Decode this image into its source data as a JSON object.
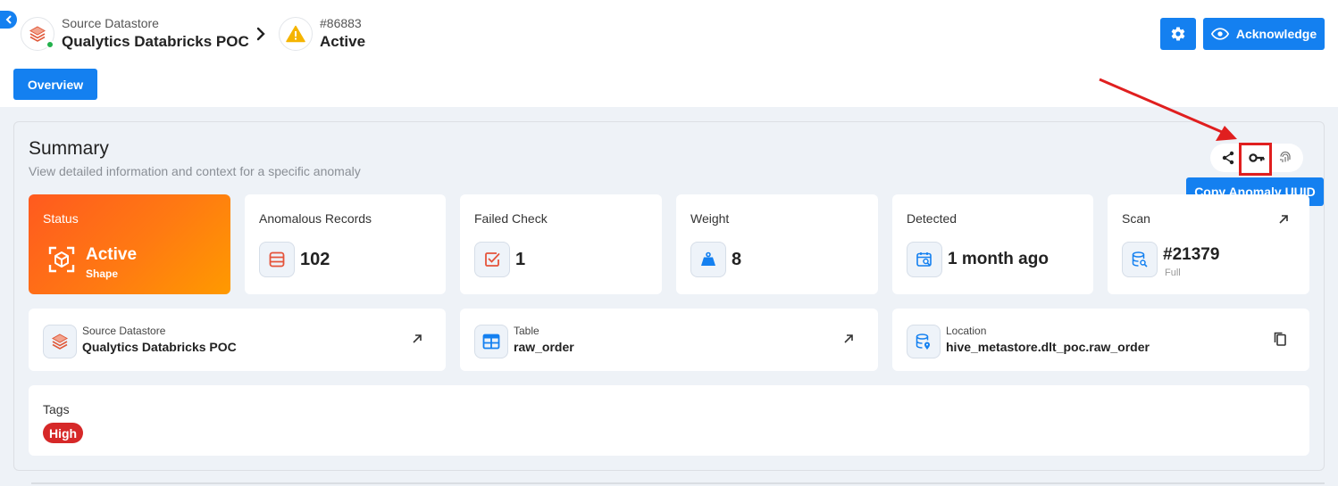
{
  "breadcrumb": {
    "datastore_kicker": "Source Datastore",
    "datastore_name": "Qualytics Databricks POC",
    "anomaly_id": "#86883",
    "anomaly_status": "Active"
  },
  "toolbar": {
    "acknowledge_label": "Acknowledge"
  },
  "tabs": [
    {
      "label": "Overview",
      "active": true
    }
  ],
  "summary": {
    "title": "Summary",
    "subtitle": "View detailed information and context for a specific anomaly",
    "tooltip": "Copy Anomaly UUID"
  },
  "metrics": {
    "status": {
      "label": "Status",
      "value": "Active",
      "sub": "Shape"
    },
    "anomalous_records": {
      "label": "Anomalous Records",
      "value": "102"
    },
    "failed_check": {
      "label": "Failed Check",
      "value": "1"
    },
    "weight": {
      "label": "Weight",
      "value": "8"
    },
    "detected": {
      "label": "Detected",
      "value": "1 month ago"
    },
    "scan": {
      "label": "Scan",
      "value": "#21379",
      "sub": "Full"
    }
  },
  "details": {
    "source_datastore": {
      "label": "Source Datastore",
      "value": "Qualytics Databricks POC"
    },
    "table": {
      "label": "Table",
      "value": "raw_order"
    },
    "location": {
      "label": "Location",
      "value": "hive_metastore.dlt_poc.raw_order"
    }
  },
  "tags": {
    "label": "Tags",
    "items": [
      "High"
    ]
  },
  "colors": {
    "primary": "#1480f0",
    "status_gradient_start": "#ff5a1f",
    "status_gradient_end": "#ff9a00",
    "tag_high": "#d62828",
    "highlight": "#e01f1f"
  }
}
